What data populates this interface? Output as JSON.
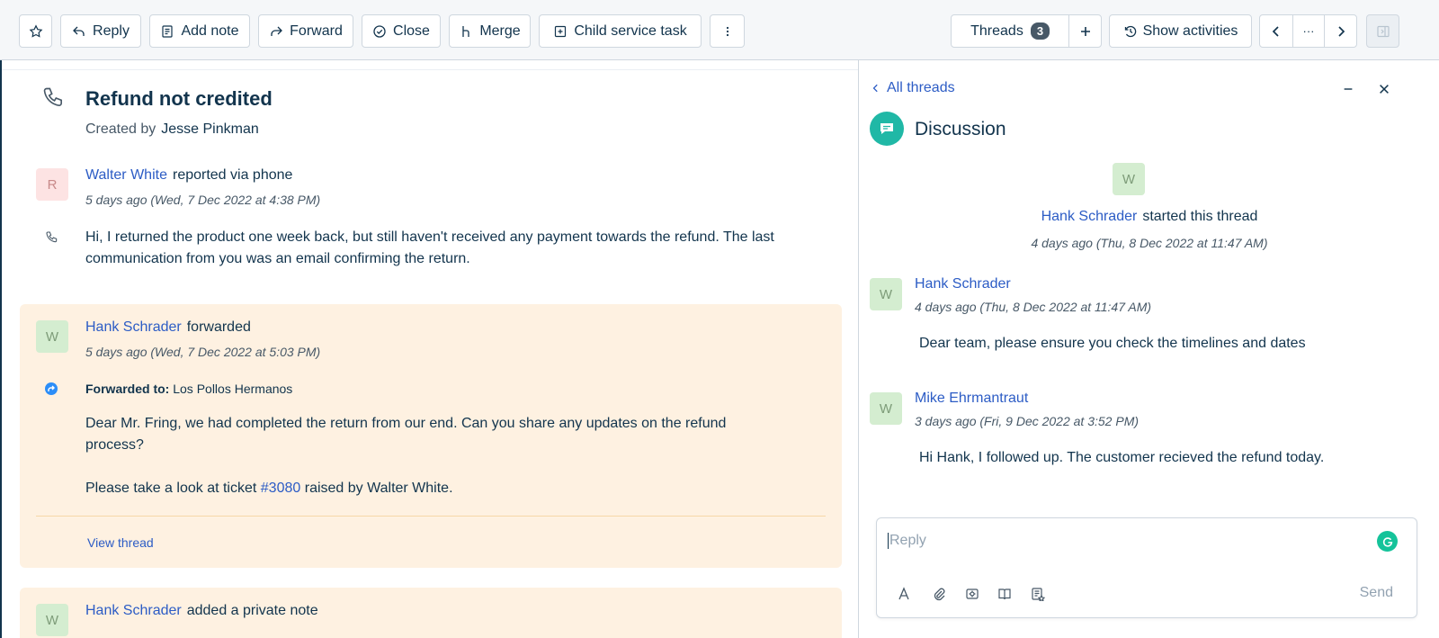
{
  "toolbar": {
    "reply": "Reply",
    "add_note": "Add note",
    "forward": "Forward",
    "close": "Close",
    "merge": "Merge",
    "child_task": "Child service task",
    "threads_label": "Threads",
    "threads_count": "3",
    "show_activities": "Show activities",
    "nav_more": "···"
  },
  "ticket": {
    "title": "Refund not credited",
    "created_by_label": "Created by",
    "created_by": "Jesse Pinkman"
  },
  "conversation": [
    {
      "avatar": "R",
      "author": "Walter White",
      "action": "reported via phone",
      "time": "5 days ago (Wed, 7 Dec 2022 at 4:38 PM)",
      "body": "Hi, I returned the product one week back, but still haven't received any payment towards the refund. The last communication from you was an email confirming the return."
    },
    {
      "avatar": "W",
      "author": "Hank Schrader",
      "action": "forwarded",
      "time": "5 days ago (Wed, 7 Dec 2022 at 5:03 PM)",
      "forwarded_label": "Forwarded to:",
      "forwarded_to": "Los Pollos Hermanos",
      "body": "Dear Mr. Fring, we had completed the return from our end. Can you share any updates on the refund process?",
      "body2_prefix": "Please take a look at ticket",
      "ticket_link": "#3080",
      "body2_suffix": "raised by Walter White.",
      "view_thread": "View thread"
    },
    {
      "avatar": "W",
      "author": "Hank Schrader",
      "action": "added a private note"
    }
  ],
  "thread_panel": {
    "back_label": "All threads",
    "title": "Discussion",
    "starter": {
      "avatar": "W",
      "author": "Hank Schrader",
      "action": "started this thread",
      "time": "4 days ago (Thu, 8 Dec 2022 at 11:47 AM)"
    },
    "messages": [
      {
        "avatar": "W",
        "author": "Hank Schrader",
        "time": "4 days ago (Thu, 8 Dec 2022 at 11:47 AM)",
        "body": "Dear team, please ensure you check the timelines and dates"
      },
      {
        "avatar": "W",
        "author": "Mike Ehrmantraut",
        "time": "3 days ago (Fri, 9 Dec 2022 at 3:52 PM)",
        "body": "Hi Hank, I followed up. The customer recieved the refund today."
      }
    ],
    "reply_placeholder": "Reply",
    "send_label": "Send"
  },
  "colors": {
    "link": "#2c5cc5",
    "card_bg": "#fef1e1",
    "discussion_icon": "#20b8a6",
    "text": "#12344d"
  },
  "icons": [
    "star-icon",
    "reply-icon",
    "note-icon",
    "forward-icon",
    "check-circle-icon",
    "merge-icon",
    "plus-square-icon",
    "kebab-icon",
    "plus-icon",
    "activity-icon",
    "chevron-left-icon",
    "chevron-right-icon",
    "panel-icon",
    "phone-icon",
    "forward-circle-icon",
    "minimize-icon",
    "close-icon",
    "chat-icon",
    "text-format-icon",
    "attachment-icon",
    "canned-response-icon",
    "knowledge-base-icon",
    "ticket-list-icon",
    "grammarly-icon"
  ]
}
